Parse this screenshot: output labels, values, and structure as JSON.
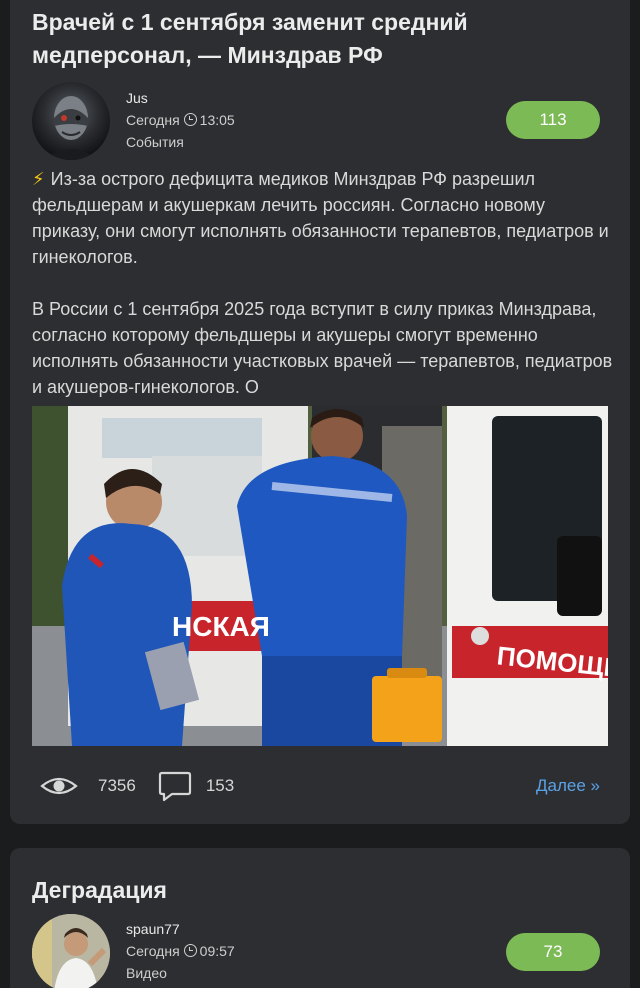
{
  "posts": [
    {
      "title": "Врачей с 1 сентября заменит средний медперсонал, — Минздрав РФ",
      "author": "Jus",
      "date": "Сегодня",
      "time": "13:05",
      "category": "События",
      "score": "113",
      "bolt": "⚡",
      "paragraphs": [
        "Из-за острого дефицита медиков Минздрав РФ разрешил фельдшерам и акушеркам лечить россиян. Согласно новому приказу, они смогут исполнять обязанности терапевтов, педиатров и гинекологов.",
        "В России с 1 сентября 2025 года вступит в силу приказ Минздрава, согласно которому фельдшеры и акушеры смогут временно исполнять обязанности участковых врачей — терапевтов, педиатров и акушеров-гинекологов. О"
      ],
      "image_texts": {
        "ambulance_left": "НСКАЯ",
        "ambulance_right": "ПОМОЩЬ"
      },
      "views": "7356",
      "comments": "153",
      "more_label": "Далее »"
    },
    {
      "title": "Деградация",
      "author": "spaun77",
      "date": "Сегодня",
      "time": "09:57",
      "category": "Видео",
      "score": "73"
    }
  ],
  "colors": {
    "background": "#1b1c1e",
    "card": "#2d2e31",
    "score_badge": "#7cba55",
    "link": "#5aa2e6",
    "bolt": "#f2c21a"
  },
  "icons": {
    "views": "eye-icon",
    "comments": "comment-icon",
    "time": "clock-icon"
  }
}
